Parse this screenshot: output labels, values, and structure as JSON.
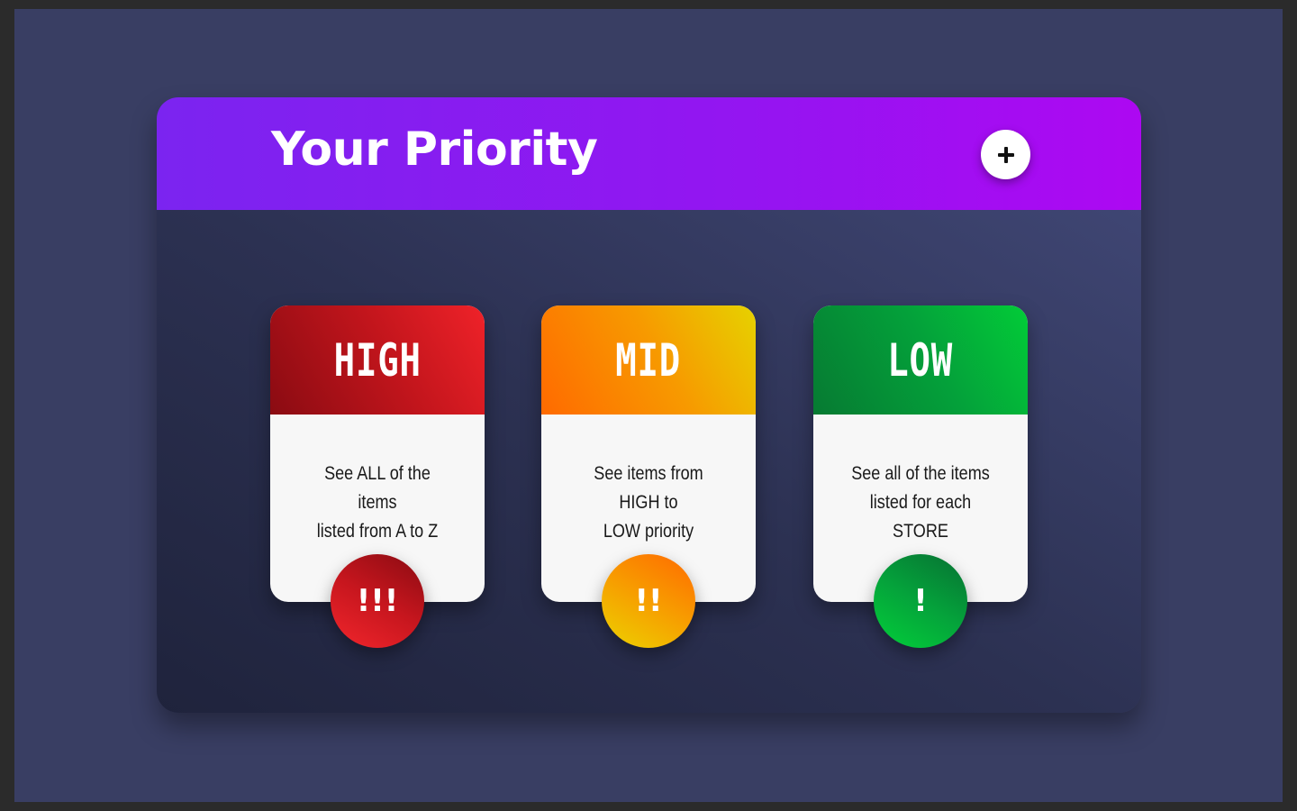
{
  "header": {
    "title": "Your Priority",
    "add_icon": "plus-icon"
  },
  "cards": [
    {
      "label": "HIGH",
      "description_line1": "See ALL of the items",
      "description_line2": "listed from A to Z",
      "badge": "!!!",
      "colors": [
        "#8a0b12",
        "#ef2229"
      ]
    },
    {
      "label": "MID",
      "description_line1": "See items from HIGH to",
      "description_line2": "LOW priority",
      "badge": "!!",
      "colors": [
        "#ff6a00",
        "#e6d200"
      ]
    },
    {
      "label": "LOW",
      "description_line1": "See all of the items",
      "description_line2": "listed for each STORE",
      "badge": "!",
      "colors": [
        "#067a32",
        "#02cc38"
      ]
    }
  ],
  "colors": {
    "header_start": "#7b24f0",
    "header_end": "#ad08f2",
    "background": "#393e63"
  }
}
